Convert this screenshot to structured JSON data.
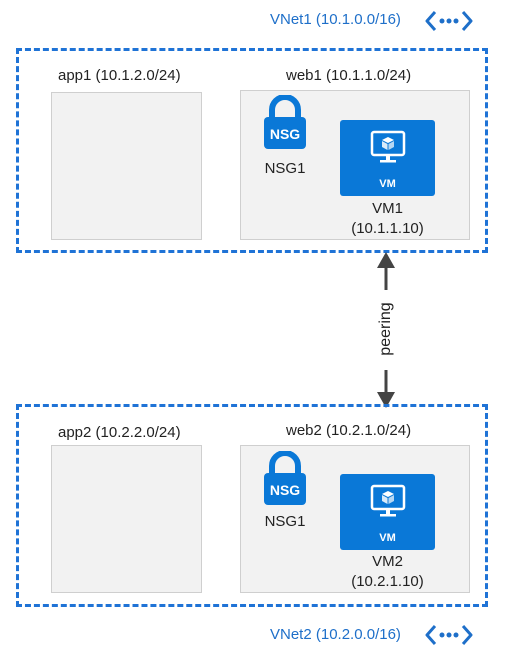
{
  "vnet1": {
    "title": "VNet1 (10.1.0.0/16)",
    "icon": "vnet-icon",
    "app_subnet": "app1 (10.1.2.0/24)",
    "web_subnet": "web1 (10.1.1.0/24)",
    "nsg_label": "NSG1",
    "nsg_badge": "NSG",
    "vm_badge": "VM",
    "vm_name": "VM1",
    "vm_ip": "(10.1.1.10)"
  },
  "vnet2": {
    "title": "VNet2 (10.2.0.0/16)",
    "icon": "vnet-icon",
    "app_subnet": "app2 (10.2.2.0/24)",
    "web_subnet": "web2 (10.2.1.0/24)",
    "nsg_label": "NSG1",
    "nsg_badge": "NSG",
    "vm_badge": "VM",
    "vm_name": "VM2",
    "vm_ip": "(10.2.1.10)"
  },
  "peering": {
    "label": "peering"
  },
  "colors": {
    "azure_blue": "#0a78d7",
    "dashed_border": "#1f73d6",
    "subnet_fill": "#f2f2f2",
    "arrow": "#444444"
  }
}
